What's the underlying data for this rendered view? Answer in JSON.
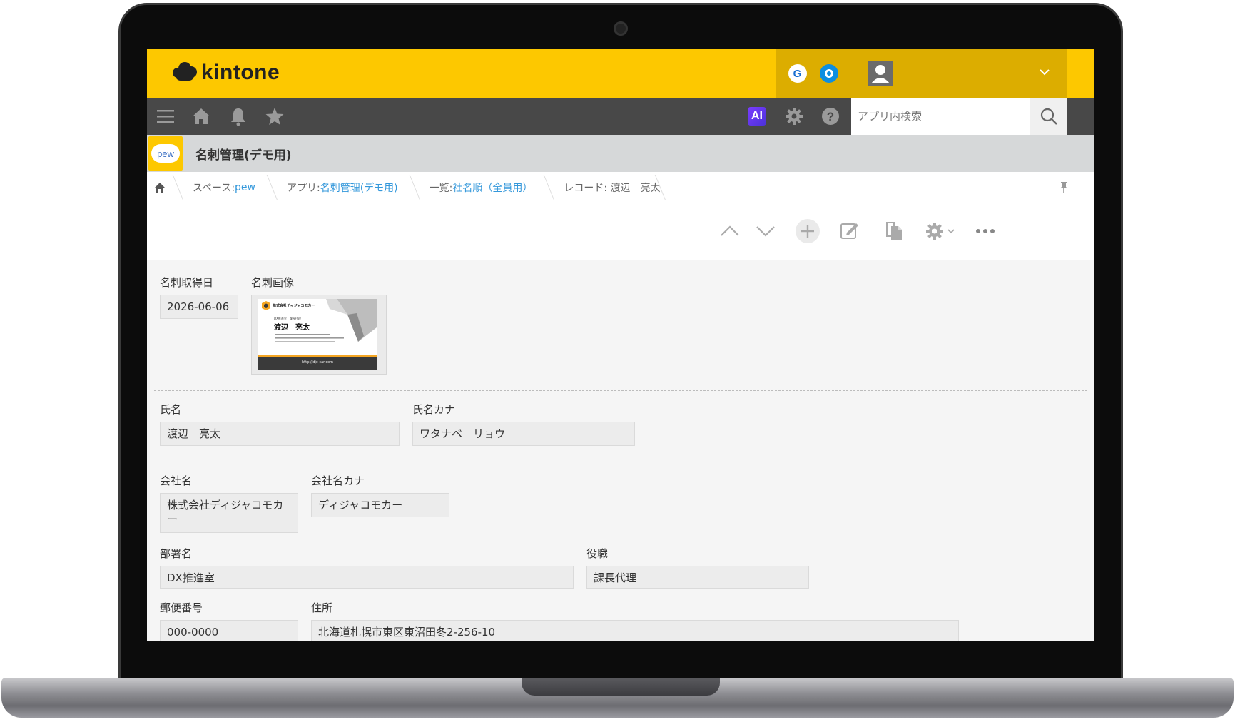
{
  "header": {
    "logo_text": "kintone",
    "app_g": "G",
    "app_o": "O"
  },
  "search": {
    "placeholder": "アプリ内検索"
  },
  "toolbar": {
    "ai_label": "AI"
  },
  "app": {
    "icon_text": "pew",
    "title": "名刺管理(デモ用)"
  },
  "breadcrumb": {
    "space_prefix": "スペース: ",
    "space_link": "pew",
    "app_prefix": "アプリ: ",
    "app_link": "名刺管理(デモ用)",
    "list_prefix": "一覧: ",
    "list_link": "社名順（全員用）",
    "record_text": "レコード: 渡辺　亮太"
  },
  "record": {
    "card_date_label": "名刺取得日",
    "card_date_value": "2026-06-06",
    "card_image_label": "名刺画像",
    "name_label": "氏名",
    "name_value": "渡辺　亮太",
    "kana_label": "氏名カナ",
    "kana_value": "ワタナベ　リョウ",
    "company_label": "会社名",
    "company_value": "株式会社ディジャコモカー",
    "company_kana_label": "会社名カナ",
    "company_kana_value": "ディジャコモカー",
    "dept_label": "部署名",
    "dept_value": "DX推進室",
    "title_label": "役職",
    "title_value": "課長代理",
    "zip_label": "郵便番号",
    "zip_value": "000-0000",
    "address_label": "住所",
    "address_value": "北海道札幌市東区東沼田冬2-256-10"
  },
  "business_card": {
    "company": "株式会社ディジャコモカー",
    "dept": "DX推進室　課長代理",
    "name": "渡辺　亮太",
    "address": "北海道札幌市東区東沼田冬2-256-10",
    "tel": "TEL 000-0000-0000　FAX 000-000-0000",
    "email": "Email: watanabe@djc-car.co.jp",
    "url": "http://djc-car.com"
  },
  "colors": {
    "kintone_yellow": "#fdc800",
    "header_dark_yellow": "#dcad00",
    "toolbar_gray": "#484848",
    "link_blue": "#3498db"
  }
}
